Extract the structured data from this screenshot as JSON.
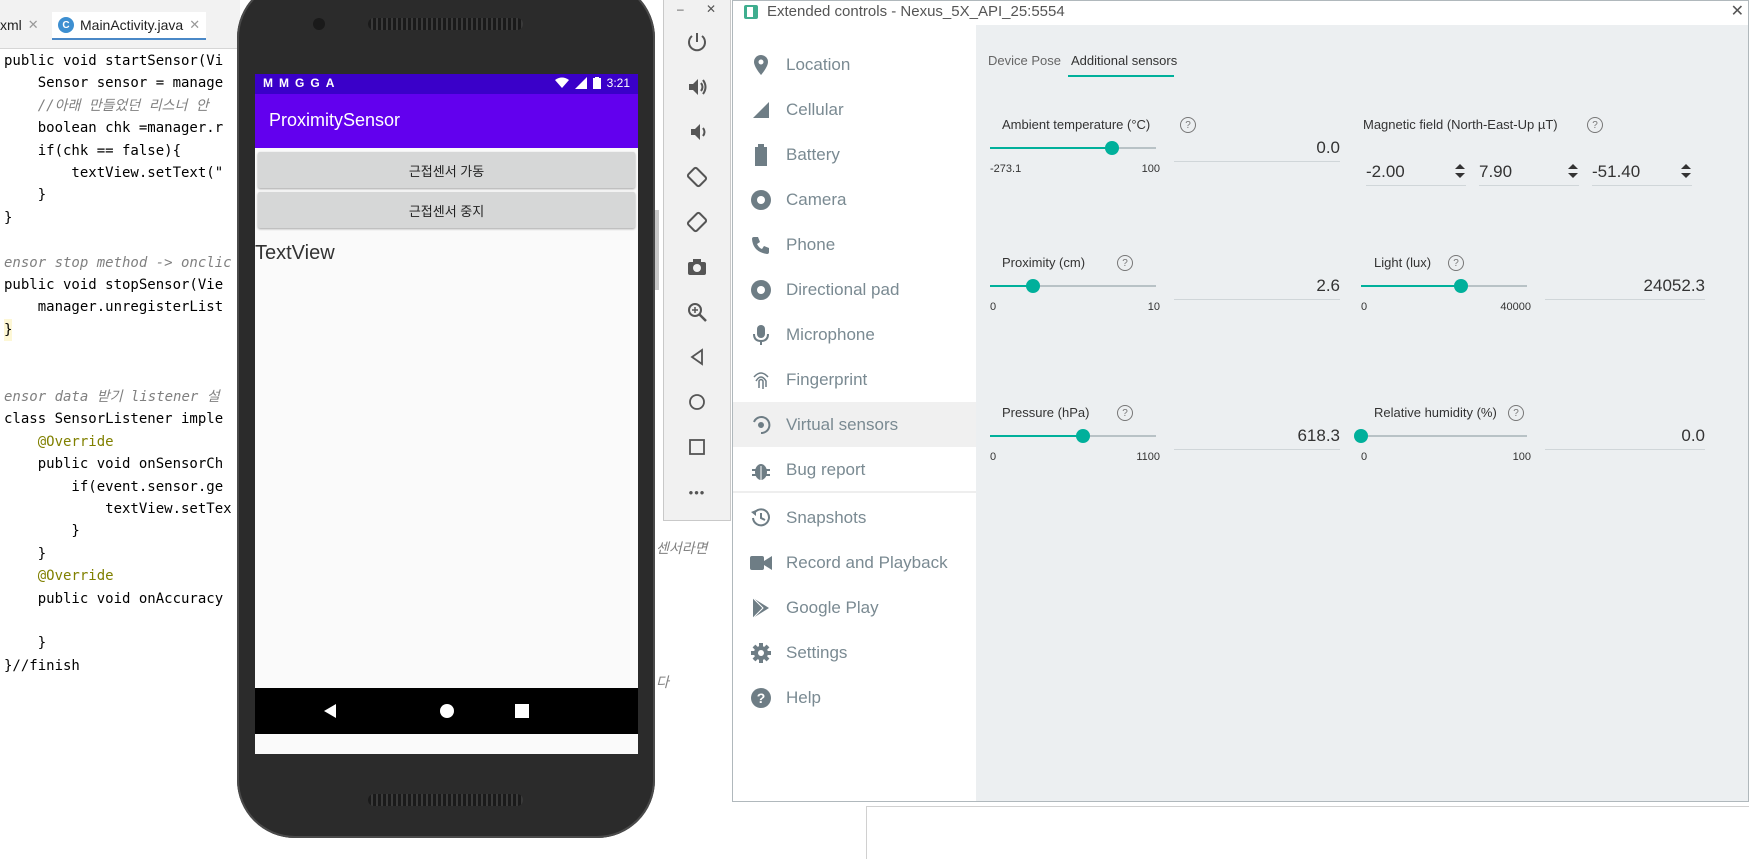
{
  "ide": {
    "tabs": [
      {
        "label": "xml",
        "close": "✕"
      },
      {
        "label": "MainActivity.java",
        "close": "✕",
        "icon": "C"
      }
    ],
    "code_lines": [
      "public void startSensor(Vi",
      "    Sensor sensor = manage",
      "    //아래 만들었던 리스너 안",
      "    boolean chk =manager.r",
      "    if(chk == false){",
      "        textView.setText(\"",
      "    }",
      "}",
      "",
      "ensor stop method -> onclic",
      "public void stopSensor(Vie",
      "    manager.unregisterList",
      "}",
      "",
      "",
      "ensor data 받기 listener 설",
      "class SensorListener imple",
      "    @Override",
      "    public void onSensorCh",
      "        if(event.sensor.ge",
      "            textView.setTex",
      "        }",
      "    }",
      "    @Override",
      "    public void onAccuracy",
      "",
      "    }",
      "}//finish"
    ],
    "fragment_right_1": "센서라면",
    "fragment_right_2": "다"
  },
  "phone": {
    "status_left_icons": [
      "M",
      "M",
      "G",
      "G",
      "A"
    ],
    "status_time": "3:21",
    "app_title": "ProximitySensor",
    "button_start": "근접센서 가동",
    "button_stop": "근접센서 중지",
    "textview": "TextView"
  },
  "emulator_toolbar": {
    "minimize": "–",
    "close": "✕",
    "buttons": [
      "power-icon",
      "volume-up-icon",
      "volume-down-icon",
      "rotate-left-icon",
      "rotate-right-icon",
      "camera-screenshot-icon",
      "zoom-icon",
      "back-icon",
      "home-icon",
      "overview-icon",
      "more-icon"
    ],
    "more_label": "•••"
  },
  "extended": {
    "window_title": "Extended controls - Nexus_5X_API_25:5554",
    "close": "✕",
    "nav": [
      {
        "label": "Location",
        "icon": "location-icon"
      },
      {
        "label": "Cellular",
        "icon": "cellular-icon"
      },
      {
        "label": "Battery",
        "icon": "battery-icon"
      },
      {
        "label": "Camera",
        "icon": "camera-icon"
      },
      {
        "label": "Phone",
        "icon": "phone-icon"
      },
      {
        "label": "Directional pad",
        "icon": "dpad-icon"
      },
      {
        "label": "Microphone",
        "icon": "microphone-icon"
      },
      {
        "label": "Fingerprint",
        "icon": "fingerprint-icon"
      },
      {
        "label": "Virtual sensors",
        "icon": "virtual-sensors-icon",
        "active": true
      },
      {
        "label": "Bug report",
        "icon": "bug-icon"
      },
      {
        "label": "Snapshots",
        "icon": "snapshots-icon"
      },
      {
        "label": "Record and Playback",
        "icon": "record-icon"
      },
      {
        "label": "Google Play",
        "icon": "google-play-icon"
      },
      {
        "label": "Settings",
        "icon": "settings-icon"
      },
      {
        "label": "Help",
        "icon": "help-icon"
      }
    ],
    "tabs": {
      "device_pose": "Device Pose",
      "additional": "Additional sensors"
    },
    "help_glyph": "?",
    "sensors": {
      "ambient": {
        "label": "Ambient temperature (°C)",
        "min": "-273.1",
        "max": "100",
        "value": "0.0",
        "level": 0.732
      },
      "magnetic": {
        "label": "Magnetic field (North-East-Up µT)",
        "x": "-2.00",
        "y": "7.90",
        "z": "-51.40"
      },
      "proximity": {
        "label": "Proximity (cm)",
        "min": "0",
        "max": "10",
        "value": "2.6",
        "level": 0.26
      },
      "light": {
        "label": "Light (lux)",
        "min": "0",
        "max": "40000",
        "value": "24052.3",
        "level": 0.6
      },
      "pressure": {
        "label": "Pressure (hPa)",
        "min": "0",
        "max": "1100",
        "value": "618.3",
        "level": 0.562
      },
      "humidity": {
        "label": "Relative humidity (%)",
        "min": "0",
        "max": "100",
        "value": "0.0",
        "level": 0.0
      }
    },
    "accent": "#00b09b"
  }
}
